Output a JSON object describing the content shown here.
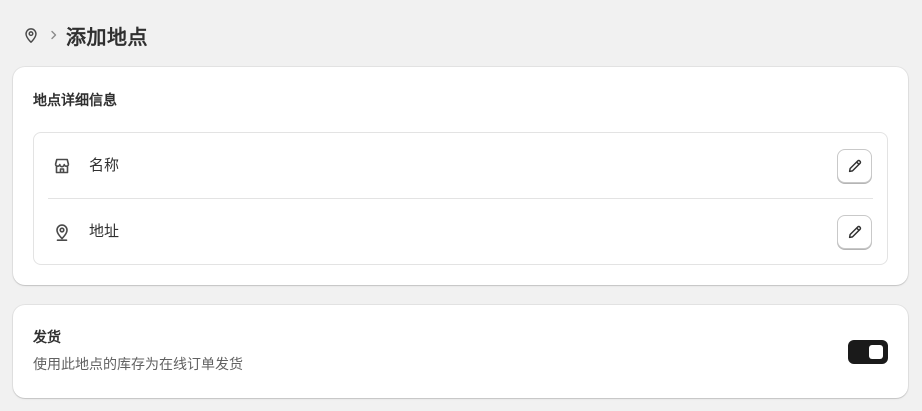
{
  "header": {
    "icon": "location-pin-icon",
    "separator_icon": "chevron-right-icon",
    "title": "添加地点"
  },
  "details_card": {
    "title": "地点详细信息",
    "rows": [
      {
        "icon": "store-icon",
        "label": "名称",
        "action_icon": "pencil-icon"
      },
      {
        "icon": "location-pin-icon",
        "label": "地址",
        "action_icon": "pencil-icon"
      }
    ]
  },
  "shipping_card": {
    "title": "发货",
    "description": "使用此地点的库存为在线订单发货",
    "toggle_on": true
  },
  "colors": {
    "background": "#f1f1f1",
    "card": "#ffffff",
    "text": "#303030",
    "muted_text": "#616161",
    "toggle_on": "#1a1a1a"
  }
}
